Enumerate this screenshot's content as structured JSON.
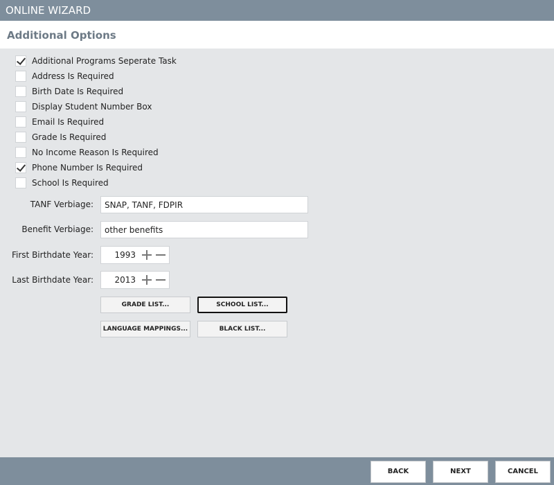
{
  "window": {
    "title": "ONLINE WIZARD"
  },
  "section": {
    "title": "Additional Options"
  },
  "options": [
    {
      "label": "Additional Programs Seperate Task",
      "checked": true
    },
    {
      "label": "Address Is Required",
      "checked": false
    },
    {
      "label": "Birth Date Is Required",
      "checked": false
    },
    {
      "label": "Display Student Number Box",
      "checked": false
    },
    {
      "label": "Email Is Required",
      "checked": false
    },
    {
      "label": "Grade Is Required",
      "checked": false
    },
    {
      "label": "No Income Reason Is Required",
      "checked": false
    },
    {
      "label": "Phone Number Is Required",
      "checked": true
    },
    {
      "label": "School Is Required",
      "checked": false
    }
  ],
  "fields": {
    "tanf": {
      "label": "TANF Verbiage:",
      "value": "SNAP, TANF, FDPIR"
    },
    "benefit": {
      "label": "Benefit Verbiage:",
      "value": "other benefits"
    },
    "first_year": {
      "label": "First Birthdate Year:",
      "value": "1993"
    },
    "last_year": {
      "label": "Last Birthdate Year:",
      "value": "2013"
    }
  },
  "buttons": {
    "grade_list": "GRADE LIST...",
    "school_list": "SCHOOL LIST...",
    "language_mappings": "LANGUAGE MAPPINGS...",
    "black_list": "BLACK LIST..."
  },
  "footer": {
    "back": "BACK",
    "next": "NEXT",
    "cancel": "CANCEL"
  },
  "colors": {
    "titlebar": "#7e8e9c",
    "content_bg": "#e4e6e8",
    "header_text": "#6d7a86"
  }
}
